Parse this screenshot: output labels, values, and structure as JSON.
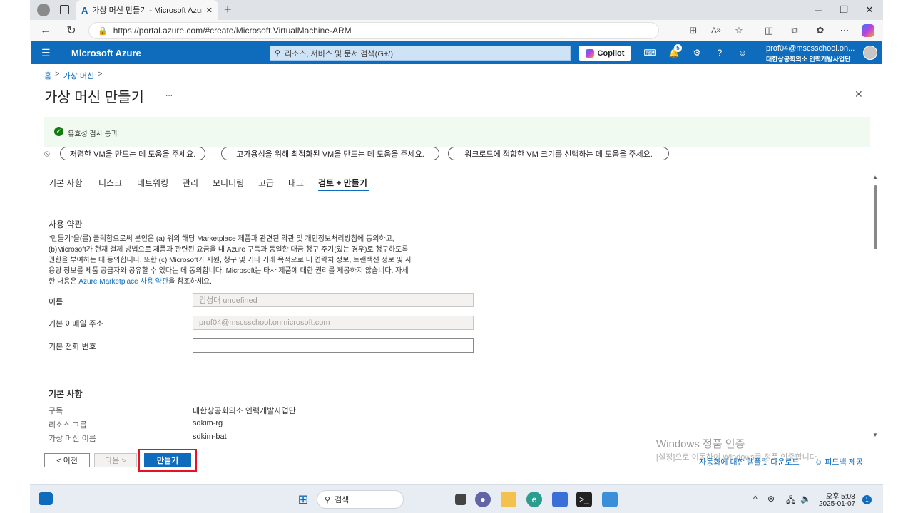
{
  "browser": {
    "tab_title": "가상 머신 만들기 - Microsoft Azure",
    "url": "https://portal.azure.com/#create/Microsoft.VirtualMachine-ARM"
  },
  "azure_header": {
    "brand": "Microsoft Azure",
    "search_placeholder": "리소스, 서비스 및 문서 검색(G+/)",
    "copilot_label": "Copilot",
    "notification_count": "5",
    "account_email": "prof04@mscsschool.on...",
    "account_org": "대한상공회의소 인력개발사업단"
  },
  "breadcrumb": {
    "home": "홈",
    "sep1": ">",
    "vm": "가상 머신",
    "sep2": ">"
  },
  "page": {
    "title": "가상 머신 만들기",
    "more": "...",
    "close": "✕"
  },
  "validation": {
    "text": "유효성 검사 통과"
  },
  "suggestions": [
    "저렴한 VM을 만드는 데 도움을 주세요.",
    "고가용성을 위해 최적화된 VM을 만드는 데 도움을 주세요.",
    "워크로드에 적합한 VM 크기를 선택하는 데 도움을 주세요."
  ],
  "tabs": [
    "기본 사항",
    "디스크",
    "네트워킹",
    "관리",
    "모니터링",
    "고급",
    "태그",
    "검토 + 만들기"
  ],
  "terms": {
    "heading": "사용 약관",
    "line1": "\"만들기\"을(를) 클릭함으로써 본인은 (a) 위의 해당 Marketplace 제품과 관련된 약관 및 개인정보처리방침에 동의하고,",
    "line2": "(b)Microsoft가 현재 결제 방법으로 제품과 관련된 요금을 내 Azure 구독과 동일한 대금 청구 주기(있는 경우)로 청구하도록",
    "line3": "권한을 부여하는 데 동의합니다. 또한 (c) Microsoft가 지원, 청구 및 기타 거래 목적으로 내 연락처 정보, 트랜잭션 정보 및 사",
    "line4": "용량 정보를 제품 공급자와 공유할 수 있다는 데 동의합니다. Microsoft는 타사 제품에 대한 권리를 제공하지 않습니다. 자세",
    "line5_pre": "한 내용은 ",
    "line5_link": "Azure Marketplace 사용 약관",
    "line5_post": "을 참조하세요."
  },
  "form": {
    "name_label": "이름",
    "name_value": "김성대 undefined",
    "email_label": "기본 이메일 주소",
    "email_value": "prof04@mscsschool.onmicrosoft.com",
    "phone_label": "기본 전화 번호",
    "phone_value": ""
  },
  "basics": {
    "heading": "기본 사항",
    "rows": [
      {
        "label": "구독",
        "value": "대한상공회의소 인력개발사업단"
      },
      {
        "label": "리소스 그룹",
        "value": "sdkim-rg"
      },
      {
        "label": "가상 머신 이름",
        "value": "sdkim-bat"
      }
    ]
  },
  "footer": {
    "prev": "< 이전",
    "next": "다음 >",
    "create": "만들기",
    "download_template": "자동화에 대한 템플릿 다운로드",
    "feedback": "피드백 제공"
  },
  "watermark": {
    "title": "Windows 정품 인증",
    "subtitle": "[설정]으로 이동하여 Windows를 정품 인증합니다."
  },
  "taskbar": {
    "search": "검색",
    "time": "오후 5:08",
    "date": "2025-01-07",
    "notif_badge": "1"
  }
}
